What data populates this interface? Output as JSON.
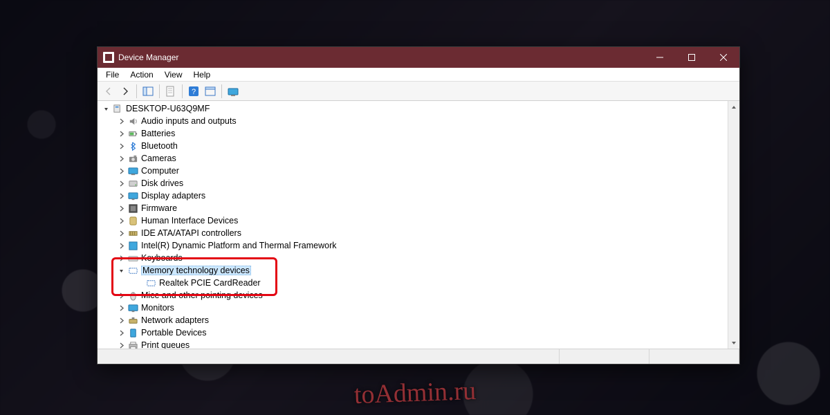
{
  "window": {
    "title": "Device Manager"
  },
  "menu": {
    "file": "File",
    "action": "Action",
    "view": "View",
    "help": "Help"
  },
  "toolbar": {
    "back": "back",
    "forward": "forward",
    "up": "show-hide-console-tree",
    "properties": "properties",
    "help": "help",
    "refresh": "scan-for-hardware-changes",
    "monitor": "update-driver"
  },
  "tree": {
    "root": "DESKTOP-U63Q9MF",
    "items": [
      {
        "label": "Audio inputs and outputs",
        "icon": "audio"
      },
      {
        "label": "Batteries",
        "icon": "battery"
      },
      {
        "label": "Bluetooth",
        "icon": "bluetooth"
      },
      {
        "label": "Cameras",
        "icon": "camera"
      },
      {
        "label": "Computer",
        "icon": "computer"
      },
      {
        "label": "Disk drives",
        "icon": "disk"
      },
      {
        "label": "Display adapters",
        "icon": "display"
      },
      {
        "label": "Firmware",
        "icon": "firmware"
      },
      {
        "label": "Human Interface Devices",
        "icon": "hid"
      },
      {
        "label": "IDE ATA/ATAPI controllers",
        "icon": "ide"
      },
      {
        "label": "Intel(R) Dynamic Platform and Thermal Framework",
        "icon": "intel"
      },
      {
        "label": "Keyboards",
        "icon": "keyboard"
      },
      {
        "label": "Memory technology devices",
        "icon": "memtech",
        "expanded": true,
        "selected": true,
        "children": [
          {
            "label": "Realtek PCIE CardReader",
            "icon": "memtech"
          }
        ]
      },
      {
        "label": "Mice and other pointing devices",
        "icon": "mouse"
      },
      {
        "label": "Monitors",
        "icon": "monitor"
      },
      {
        "label": "Network adapters",
        "icon": "network"
      },
      {
        "label": "Portable Devices",
        "icon": "portable"
      },
      {
        "label": "Print queues",
        "icon": "printer"
      }
    ]
  },
  "watermark": "toAdmin.ru"
}
